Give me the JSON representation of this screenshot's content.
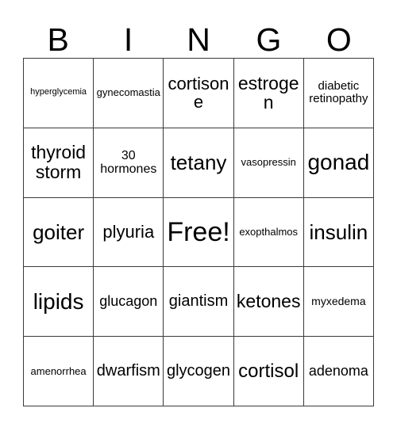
{
  "header": {
    "letters": [
      "B",
      "I",
      "N",
      "G",
      "O"
    ]
  },
  "grid": {
    "rows": 5,
    "columns": 5,
    "cells": [
      {
        "text": "hyperglycemia",
        "size": "fs-xxs"
      },
      {
        "text": "gynecomastia",
        "size": "fs-xs"
      },
      {
        "text": "cortisone",
        "size": "fs-xl"
      },
      {
        "text": "estrogen",
        "size": "fs-xxl"
      },
      {
        "text": "diabetic retinopathy",
        "size": "fs-sm"
      },
      {
        "text": "thyroid storm",
        "size": "fs-xxl"
      },
      {
        "text": "30 hormones",
        "size": "fs-m"
      },
      {
        "text": "tetany",
        "size": "fs-h2"
      },
      {
        "text": "vasopressin",
        "size": "fs-xs"
      },
      {
        "text": "gonad",
        "size": "fs-h3"
      },
      {
        "text": "goiter",
        "size": "fs-h2"
      },
      {
        "text": "plyuria",
        "size": "fs-xl"
      },
      {
        "text": "Free!",
        "size": "fs-free"
      },
      {
        "text": "exopthalmos",
        "size": "fs-xs"
      },
      {
        "text": "insulin",
        "size": "fs-h2"
      },
      {
        "text": "lipids",
        "size": "fs-h3"
      },
      {
        "text": "glucagon",
        "size": "fs-ml"
      },
      {
        "text": "giantism",
        "size": "fs-l"
      },
      {
        "text": "ketones",
        "size": "fs-xxl"
      },
      {
        "text": "myxedema",
        "size": "fs-s"
      },
      {
        "text": "amenorrhea",
        "size": "fs-xs"
      },
      {
        "text": "dwarfism",
        "size": "fs-l"
      },
      {
        "text": "glycogen",
        "size": "fs-l"
      },
      {
        "text": "cortisol",
        "size": "fs-h1"
      },
      {
        "text": "adenoma",
        "size": "fs-ml"
      }
    ]
  }
}
